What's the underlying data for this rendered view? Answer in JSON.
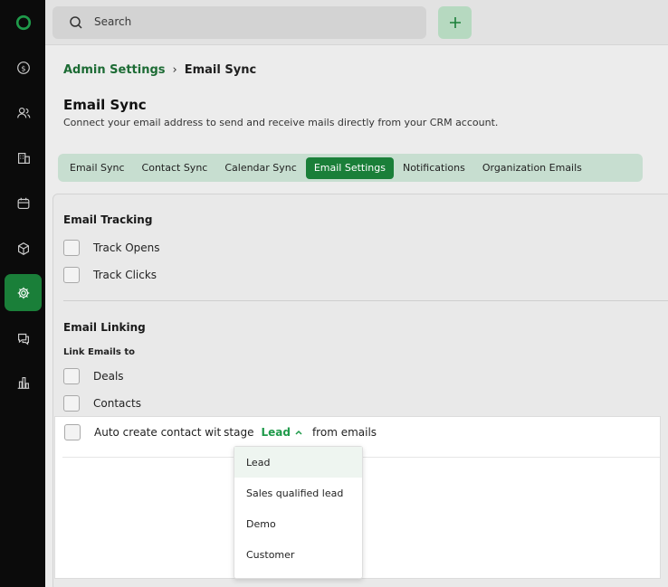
{
  "search": {
    "placeholder": "Search"
  },
  "breadcrumb": {
    "parent": "Admin Settings",
    "separator": "›",
    "current": "Email Sync"
  },
  "page": {
    "title": "Email Sync",
    "subtitle": "Connect your email address to send and receive mails directly from your CRM account."
  },
  "tabs": [
    {
      "label": "Email Sync",
      "active": false
    },
    {
      "label": "Contact Sync",
      "active": false
    },
    {
      "label": "Calendar Sync",
      "active": false
    },
    {
      "label": "Email Settings",
      "active": true
    },
    {
      "label": "Notifications",
      "active": false
    },
    {
      "label": "Organization Emails",
      "active": false
    }
  ],
  "tracking": {
    "title": "Email Tracking",
    "options": [
      {
        "label": "Track Opens",
        "checked": false
      },
      {
        "label": "Track Clicks",
        "checked": false
      }
    ]
  },
  "linking": {
    "title": "Email Linking",
    "sublabel": "Link Emails to",
    "options": [
      {
        "label": "Deals",
        "checked": false
      },
      {
        "label": "Contacts",
        "checked": false
      }
    ]
  },
  "auto_create": {
    "prefix": "Auto create contact wit",
    "stage_word": "stage",
    "selected_stage": "Lead",
    "suffix": "from emails",
    "checked": false
  },
  "stage_options": [
    "Lead",
    "Sales qualified lead",
    "Demo",
    "Customer"
  ],
  "colors": {
    "accent": "#1a7f39",
    "accent_light": "#c7ded0",
    "sidebar_bg": "#0b0b0b",
    "dropdown_link": "#1f9a4a"
  },
  "icons": {
    "sidebar": [
      "logo-icon",
      "deals-icon",
      "contacts-icon",
      "companies-icon",
      "calendar-icon",
      "products-icon",
      "settings-icon",
      "chat-icon",
      "reports-icon"
    ]
  }
}
